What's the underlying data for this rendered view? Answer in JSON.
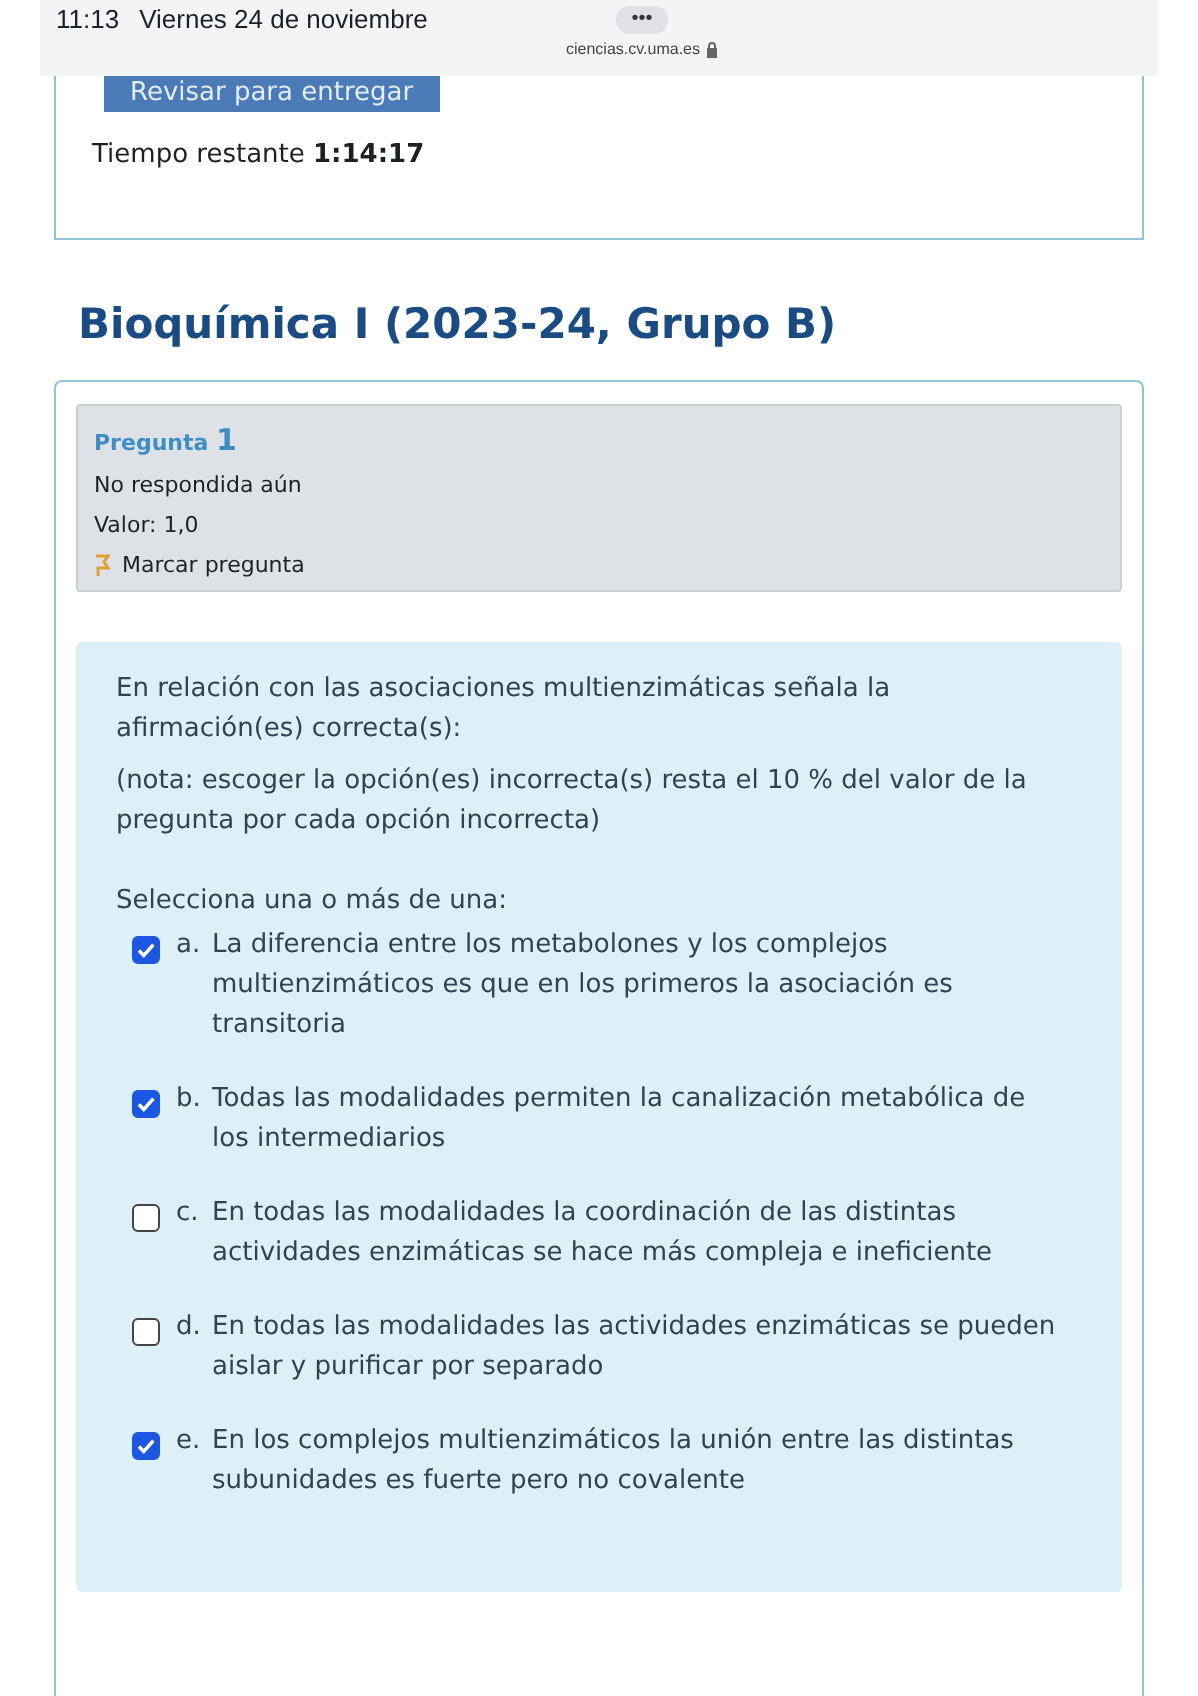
{
  "status_bar": {
    "time": "11:13",
    "date": "Viernes 24 de noviembre",
    "dots": "•••",
    "url": "ciencias.cv.uma.es"
  },
  "timer_panel": {
    "button": "Revisar para entregar",
    "time_label": "Tiempo restante",
    "time_value": "1:14:17"
  },
  "course_title": "Bioquímica I (2023-24, Grupo B)",
  "question_info": {
    "label": "Pregunta",
    "number": "1",
    "state": "No respondida aún",
    "value": "Valor: 1,0",
    "flag": "Marcar pregunta",
    "flagged": false
  },
  "question": {
    "text": "En relación con las asociaciones multienzimáticas señala la afirmación(es) correcta(s):",
    "note": "(nota: escoger la opción(es) incorrecta(s) resta el 10 % del valor de la pregunta por cada opción incorrecta)",
    "prompt": "Selecciona una o más de una:",
    "options": [
      {
        "letter": "a.",
        "text": "La diferencia entre los metabolones y los complejos multienzimáticos es que en los primeros la asociación es transitoria",
        "checked": true
      },
      {
        "letter": "b.",
        "text": "Todas las modalidades permiten la canalización metabólica de los intermediarios",
        "checked": true
      },
      {
        "letter": "c.",
        "text": "En todas las modalidades la coordinación de las distintas actividades enzimáticas se hace más compleja e ineficiente",
        "checked": false
      },
      {
        "letter": "d.",
        "text": "En todas las modalidades las actividades enzimáticas se pueden aislar y purificar por separado",
        "checked": false
      },
      {
        "letter": "e.",
        "text": "En los complejos multienzimáticos la unión entre las distintas subunidades es fuerte pero no covalente",
        "checked": true
      }
    ]
  }
}
